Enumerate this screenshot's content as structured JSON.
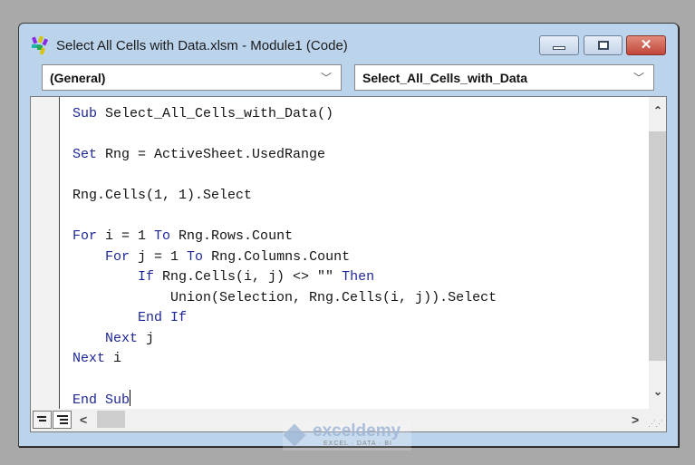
{
  "window": {
    "title": "Select All Cells with Data.xlsm - Module1 (Code)",
    "app_icon": "vba-project-icon",
    "buttons": {
      "minimize": "minimize-icon",
      "maximize": "maximize-icon",
      "close": "✕"
    }
  },
  "toolbar": {
    "object_combo": {
      "value": "(General)"
    },
    "procedure_combo": {
      "value": "Select_All_Cells_with_Data"
    },
    "dropdown_glyph": "﹀"
  },
  "editor": {
    "lines": [
      [
        {
          "t": "Sub ",
          "k": true
        },
        {
          "t": "Select_All_Cells_with_Data()",
          "k": false
        }
      ],
      [],
      [
        {
          "t": "Set ",
          "k": true
        },
        {
          "t": "Rng = ActiveSheet.UsedRange",
          "k": false
        }
      ],
      [],
      [
        {
          "t": "Rng.Cells(1, 1).Select",
          "k": false
        }
      ],
      [],
      [
        {
          "t": "For ",
          "k": true
        },
        {
          "t": "i = 1 ",
          "k": false
        },
        {
          "t": "To ",
          "k": true
        },
        {
          "t": "Rng.Rows.Count",
          "k": false
        }
      ],
      [
        {
          "t": "    ",
          "k": false
        },
        {
          "t": "For ",
          "k": true
        },
        {
          "t": "j = 1 ",
          "k": false
        },
        {
          "t": "To ",
          "k": true
        },
        {
          "t": "Rng.Columns.Count",
          "k": false
        }
      ],
      [
        {
          "t": "        ",
          "k": false
        },
        {
          "t": "If ",
          "k": true
        },
        {
          "t": "Rng.Cells(i, j) <> \"\" ",
          "k": false
        },
        {
          "t": "Then",
          "k": true
        }
      ],
      [
        {
          "t": "            Union(Selection, Rng.Cells(i, j)).Select",
          "k": false
        }
      ],
      [
        {
          "t": "        ",
          "k": false
        },
        {
          "t": "End If",
          "k": true
        }
      ],
      [
        {
          "t": "    ",
          "k": false
        },
        {
          "t": "Next ",
          "k": true
        },
        {
          "t": "j",
          "k": false
        }
      ],
      [
        {
          "t": "Next ",
          "k": true
        },
        {
          "t": "i",
          "k": false
        }
      ],
      [],
      [
        {
          "t": "End Sub",
          "k": true
        }
      ]
    ],
    "scroll_up": "⌃",
    "scroll_down": "⌄",
    "scroll_left": "<",
    "scroll_right": ">"
  },
  "watermark": {
    "name": "exceldemy",
    "tagline": "EXCEL · DATA · BI"
  }
}
